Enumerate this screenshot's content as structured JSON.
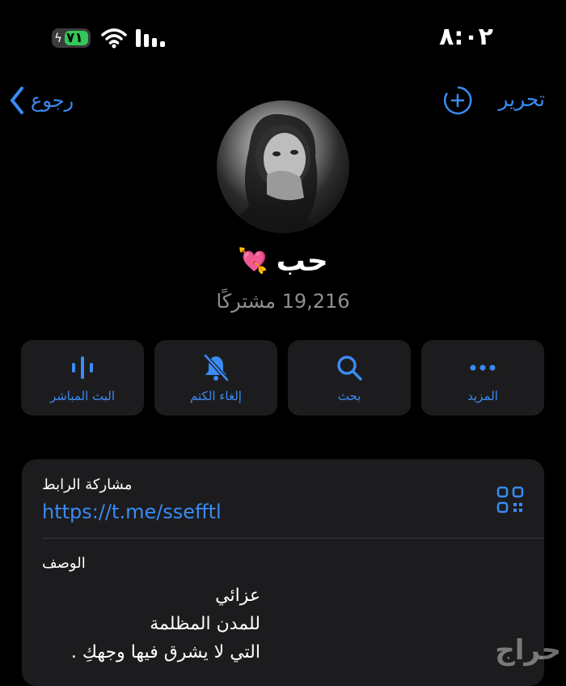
{
  "status_bar": {
    "time": "٨:٠٢",
    "battery": "٧١"
  },
  "nav": {
    "back_label": "رجوع",
    "edit_label": "تحرير"
  },
  "channel": {
    "name": "حب",
    "name_emoji": "💘",
    "subscribers": "19,216 مشتركًا"
  },
  "actions": [
    {
      "label": "البث المباشر",
      "icon": "waveform-icon"
    },
    {
      "label": "إلغاء الكتم",
      "icon": "bell-slash-icon"
    },
    {
      "label": "بحث",
      "icon": "search-icon"
    },
    {
      "label": "المزيد",
      "icon": "more-icon"
    }
  ],
  "share": {
    "title": "مشاركة الرابط",
    "link": "https://t.me/ssefftl"
  },
  "description": {
    "title": "الوصف",
    "lines": [
      "عزائي",
      "للمدن المظلمة",
      "التي لا يشرق فيها وجهكِ ."
    ]
  },
  "watermark": "حراج",
  "colors": {
    "accent": "#3a8bf5",
    "card": "#1c1c1e",
    "battery": "#34c759"
  }
}
